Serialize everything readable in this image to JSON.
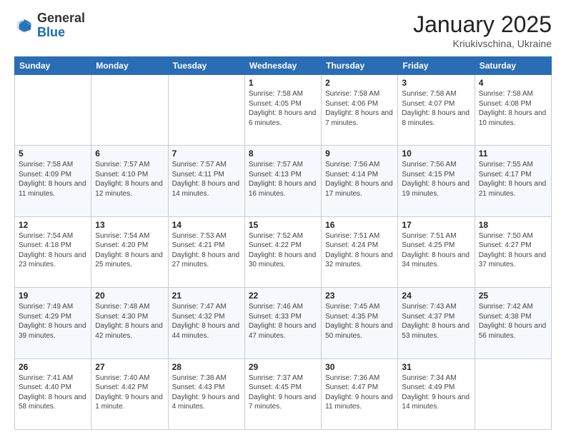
{
  "header": {
    "logo_general": "General",
    "logo_blue": "Blue",
    "month": "January 2025",
    "location": "Kriukivschina, Ukraine"
  },
  "weekdays": [
    "Sunday",
    "Monday",
    "Tuesday",
    "Wednesday",
    "Thursday",
    "Friday",
    "Saturday"
  ],
  "weeks": [
    [
      {
        "day": "",
        "info": ""
      },
      {
        "day": "",
        "info": ""
      },
      {
        "day": "",
        "info": ""
      },
      {
        "day": "1",
        "info": "Sunrise: 7:58 AM\nSunset: 4:05 PM\nDaylight: 8 hours and 6 minutes."
      },
      {
        "day": "2",
        "info": "Sunrise: 7:58 AM\nSunset: 4:06 PM\nDaylight: 8 hours and 7 minutes."
      },
      {
        "day": "3",
        "info": "Sunrise: 7:58 AM\nSunset: 4:07 PM\nDaylight: 8 hours and 8 minutes."
      },
      {
        "day": "4",
        "info": "Sunrise: 7:58 AM\nSunset: 4:08 PM\nDaylight: 8 hours and 10 minutes."
      }
    ],
    [
      {
        "day": "5",
        "info": "Sunrise: 7:58 AM\nSunset: 4:09 PM\nDaylight: 8 hours and 11 minutes."
      },
      {
        "day": "6",
        "info": "Sunrise: 7:57 AM\nSunset: 4:10 PM\nDaylight: 8 hours and 12 minutes."
      },
      {
        "day": "7",
        "info": "Sunrise: 7:57 AM\nSunset: 4:11 PM\nDaylight: 8 hours and 14 minutes."
      },
      {
        "day": "8",
        "info": "Sunrise: 7:57 AM\nSunset: 4:13 PM\nDaylight: 8 hours and 16 minutes."
      },
      {
        "day": "9",
        "info": "Sunrise: 7:56 AM\nSunset: 4:14 PM\nDaylight: 8 hours and 17 minutes."
      },
      {
        "day": "10",
        "info": "Sunrise: 7:56 AM\nSunset: 4:15 PM\nDaylight: 8 hours and 19 minutes."
      },
      {
        "day": "11",
        "info": "Sunrise: 7:55 AM\nSunset: 4:17 PM\nDaylight: 8 hours and 21 minutes."
      }
    ],
    [
      {
        "day": "12",
        "info": "Sunrise: 7:54 AM\nSunset: 4:18 PM\nDaylight: 8 hours and 23 minutes."
      },
      {
        "day": "13",
        "info": "Sunrise: 7:54 AM\nSunset: 4:20 PM\nDaylight: 8 hours and 25 minutes."
      },
      {
        "day": "14",
        "info": "Sunrise: 7:53 AM\nSunset: 4:21 PM\nDaylight: 8 hours and 27 minutes."
      },
      {
        "day": "15",
        "info": "Sunrise: 7:52 AM\nSunset: 4:22 PM\nDaylight: 8 hours and 30 minutes."
      },
      {
        "day": "16",
        "info": "Sunrise: 7:51 AM\nSunset: 4:24 PM\nDaylight: 8 hours and 32 minutes."
      },
      {
        "day": "17",
        "info": "Sunrise: 7:51 AM\nSunset: 4:25 PM\nDaylight: 8 hours and 34 minutes."
      },
      {
        "day": "18",
        "info": "Sunrise: 7:50 AM\nSunset: 4:27 PM\nDaylight: 8 hours and 37 minutes."
      }
    ],
    [
      {
        "day": "19",
        "info": "Sunrise: 7:49 AM\nSunset: 4:29 PM\nDaylight: 8 hours and 39 minutes."
      },
      {
        "day": "20",
        "info": "Sunrise: 7:48 AM\nSunset: 4:30 PM\nDaylight: 8 hours and 42 minutes."
      },
      {
        "day": "21",
        "info": "Sunrise: 7:47 AM\nSunset: 4:32 PM\nDaylight: 8 hours and 44 minutes."
      },
      {
        "day": "22",
        "info": "Sunrise: 7:46 AM\nSunset: 4:33 PM\nDaylight: 8 hours and 47 minutes."
      },
      {
        "day": "23",
        "info": "Sunrise: 7:45 AM\nSunset: 4:35 PM\nDaylight: 8 hours and 50 minutes."
      },
      {
        "day": "24",
        "info": "Sunrise: 7:43 AM\nSunset: 4:37 PM\nDaylight: 8 hours and 53 minutes."
      },
      {
        "day": "25",
        "info": "Sunrise: 7:42 AM\nSunset: 4:38 PM\nDaylight: 8 hours and 56 minutes."
      }
    ],
    [
      {
        "day": "26",
        "info": "Sunrise: 7:41 AM\nSunset: 4:40 PM\nDaylight: 8 hours and 58 minutes."
      },
      {
        "day": "27",
        "info": "Sunrise: 7:40 AM\nSunset: 4:42 PM\nDaylight: 9 hours and 1 minute."
      },
      {
        "day": "28",
        "info": "Sunrise: 7:38 AM\nSunset: 4:43 PM\nDaylight: 9 hours and 4 minutes."
      },
      {
        "day": "29",
        "info": "Sunrise: 7:37 AM\nSunset: 4:45 PM\nDaylight: 9 hours and 7 minutes."
      },
      {
        "day": "30",
        "info": "Sunrise: 7:36 AM\nSunset: 4:47 PM\nDaylight: 9 hours and 11 minutes."
      },
      {
        "day": "31",
        "info": "Sunrise: 7:34 AM\nSunset: 4:49 PM\nDaylight: 9 hours and 14 minutes."
      },
      {
        "day": "",
        "info": ""
      }
    ]
  ]
}
